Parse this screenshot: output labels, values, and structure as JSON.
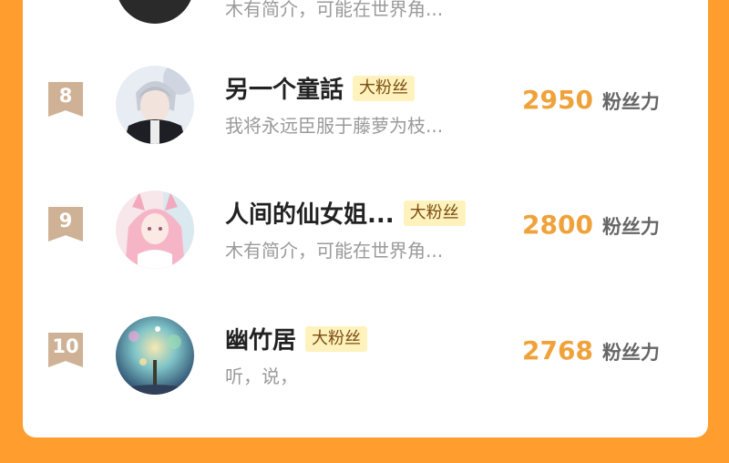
{
  "partial_row": {
    "bio": "木有简介，可能在世界角..."
  },
  "rows": [
    {
      "rank": "8",
      "name": "另一个童話",
      "badge": "大粉丝",
      "bio": "我将永远臣服于藤萝为枝...",
      "score": "2950",
      "score_unit": "粉丝力",
      "avatar": "anime-boy-avatar"
    },
    {
      "rank": "9",
      "name": "人间的仙女姐...",
      "badge": "大粉丝",
      "bio": "木有简介，可能在世界角...",
      "score": "2800",
      "score_unit": "粉丝力",
      "avatar": "pink-fox-girl-avatar"
    },
    {
      "rank": "10",
      "name": "幽竹居",
      "badge": "大粉丝",
      "bio": "听，说，",
      "score": "2768",
      "score_unit": "粉丝力",
      "avatar": "galaxy-tree-avatar"
    }
  ],
  "colors": {
    "background": "#ff9d2e",
    "score": "#f0a23a",
    "badge_bg": "#fff2bd",
    "rank_bg": "#cfb296"
  }
}
